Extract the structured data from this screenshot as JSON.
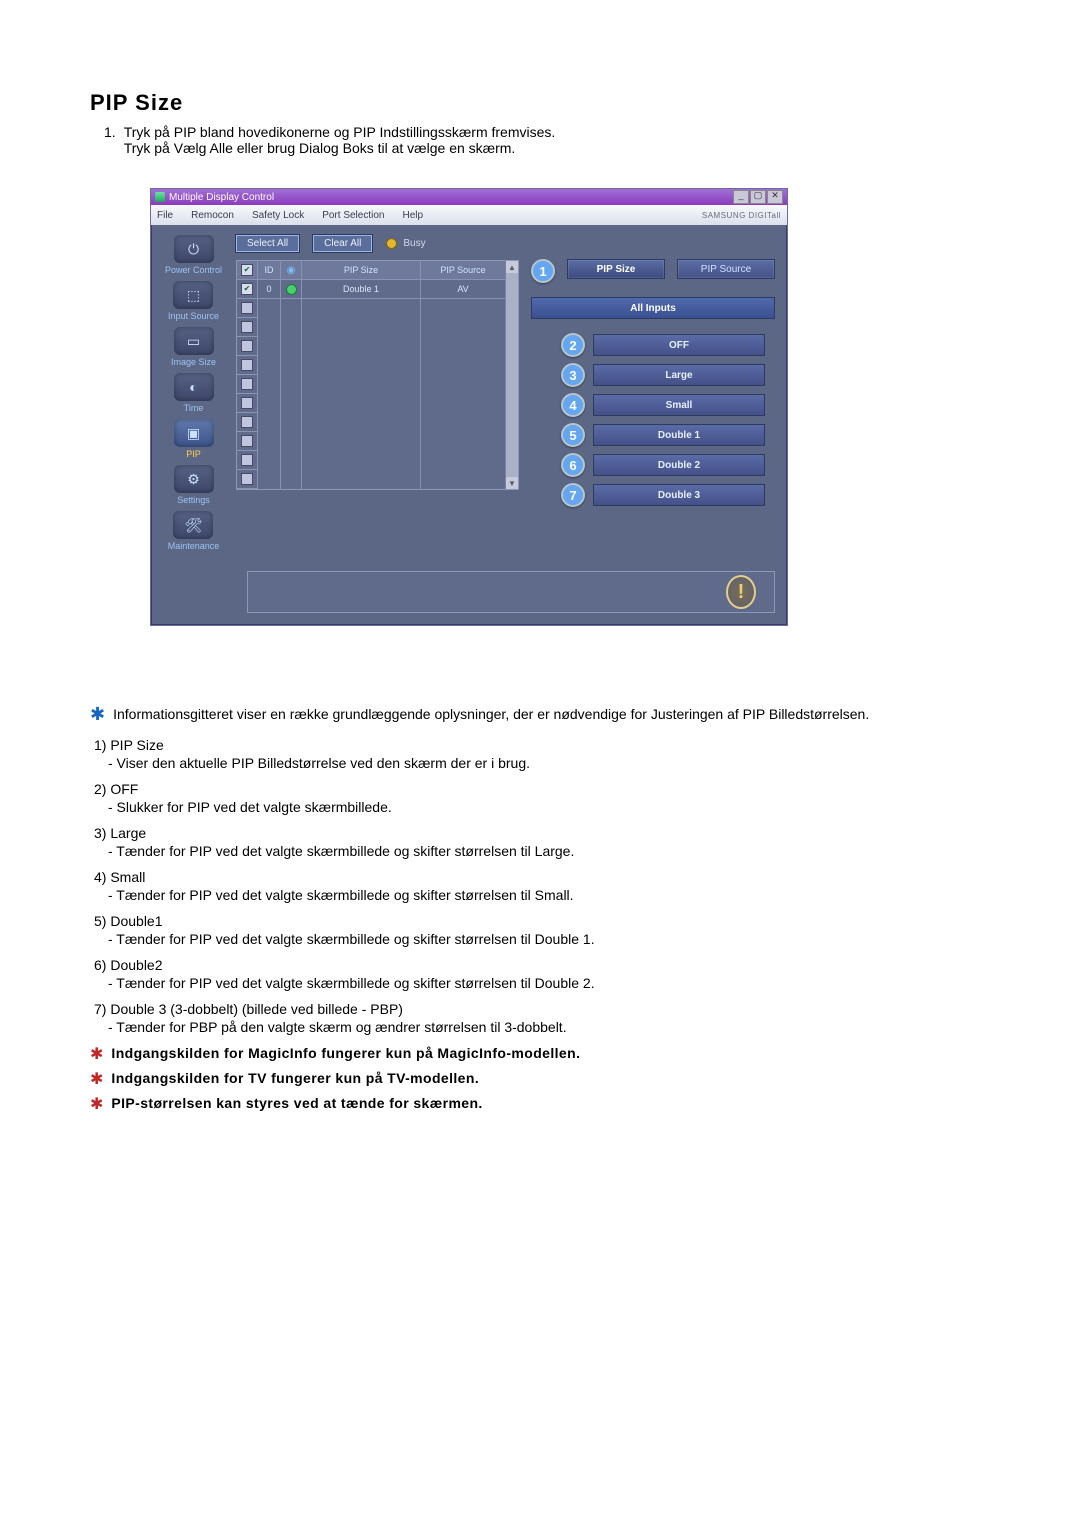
{
  "heading": "PIP Size",
  "intro": {
    "line1_num": "1.",
    "line1_a": "Tryk på PIP bland hovedikonerne og PIP Indstillingsskærm fremvises.",
    "line1_b": "Tryk på Vælg Alle eller brug Dialog Boks til at vælge en skærm."
  },
  "shot": {
    "title": "Multiple Display Control",
    "menus": [
      "File",
      "Remocon",
      "Safety Lock",
      "Port Selection",
      "Help"
    ],
    "brand": "SAMSUNG DIGITall",
    "sidebar": [
      {
        "label": "Power Control"
      },
      {
        "label": "Input Source"
      },
      {
        "label": "Image Size"
      },
      {
        "label": "Time"
      },
      {
        "label": "PIP"
      },
      {
        "label": "Settings"
      },
      {
        "label": "Maintenance"
      }
    ],
    "buttons": {
      "selectAll": "Select All",
      "clearAll": "Clear All",
      "busy": "Busy"
    },
    "grid": {
      "headers": {
        "chk": "",
        "id": "ID",
        "status": "",
        "size": "PIP Size",
        "source": "PIP Source"
      },
      "rows": [
        {
          "chk": "on",
          "id": "0",
          "status": "green",
          "size": "Double 1",
          "source": "AV"
        },
        {
          "chk": "off"
        },
        {
          "chk": "off"
        },
        {
          "chk": "off"
        },
        {
          "chk": "off"
        },
        {
          "chk": "off"
        },
        {
          "chk": "off"
        },
        {
          "chk": "off"
        },
        {
          "chk": "off"
        },
        {
          "chk": "off"
        },
        {
          "chk": "off"
        }
      ]
    },
    "tabs": {
      "size": "PIP Size",
      "source": "PIP Source"
    },
    "allInputs": "All Inputs",
    "options": [
      "OFF",
      "Large",
      "Small",
      "Double 1",
      "Double 2",
      "Double 3"
    ]
  },
  "info_paragraph": "Informationsgitteret viser en række grundlæggende oplysninger, der er nødvendige for Justeringen af PIP Billedstørrelsen.",
  "list": [
    {
      "n": "1)",
      "t": "PIP Size",
      "d": "- Viser den aktuelle PIP Billedstørrelse ved den skærm der er i brug."
    },
    {
      "n": "2)",
      "t": "OFF",
      "d": "- Slukker for PIP ved det valgte skærmbillede."
    },
    {
      "n": "3)",
      "t": "Large",
      "d": "- Tænder for PIP ved det valgte skærmbillede og skifter størrelsen til Large."
    },
    {
      "n": "4)",
      "t": "Small",
      "d": "- Tænder for PIP ved det valgte skærmbillede og skifter størrelsen til Small."
    },
    {
      "n": "5)",
      "t": "Double1",
      "d": "- Tænder for PIP ved det valgte skærmbillede og skifter størrelsen til Double 1."
    },
    {
      "n": "6)",
      "t": "Double2",
      "d": "- Tænder for PIP ved det valgte skærmbillede og skifter størrelsen til Double 2."
    },
    {
      "n": "7)",
      "t": "Double 3 (3-dobbelt) (billede ved billede - PBP)",
      "d": "- Tænder for PBP på den valgte skærm og ændrer størrelsen til 3-dobbelt."
    }
  ],
  "notes": [
    "Indgangskilden for MagicInfo fungerer kun på MagicInfo-modellen.",
    "Indgangskilden for TV fungerer kun på TV-modellen.",
    "PIP-størrelsen kan styres ved at tænde for skærmen."
  ]
}
